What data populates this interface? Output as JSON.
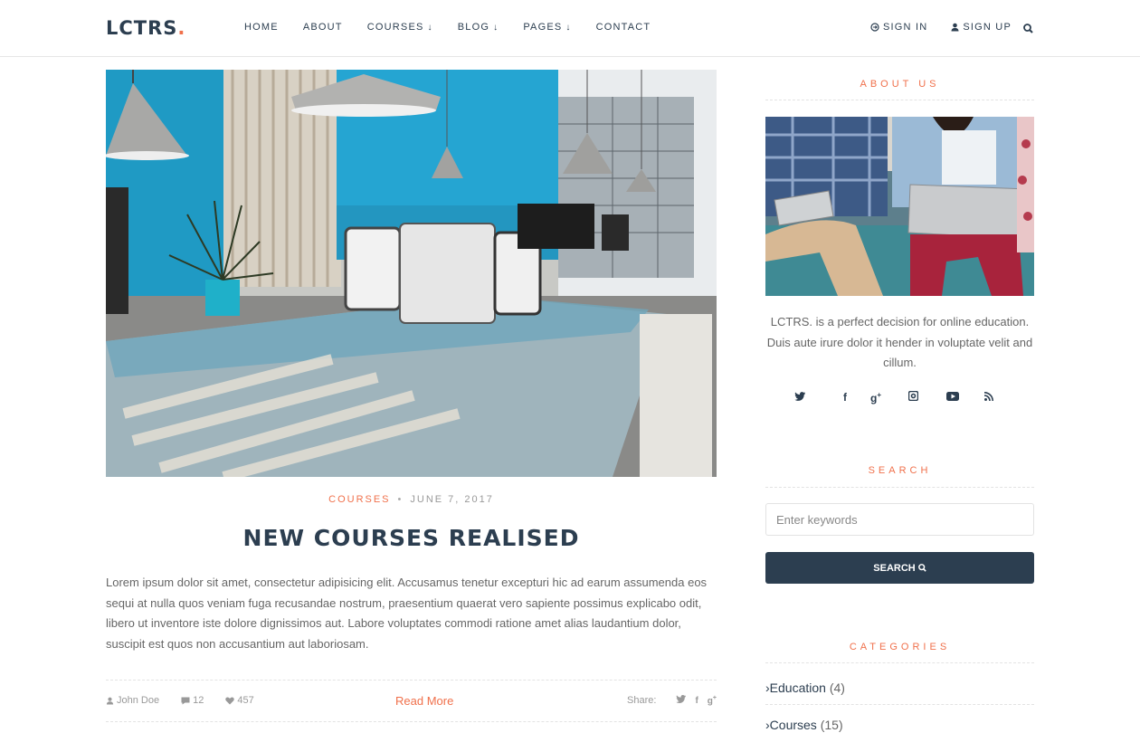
{
  "header": {
    "logo_text": "LCTRS",
    "logo_dot": ".",
    "nav": [
      {
        "label": "HOME",
        "dropdown": false
      },
      {
        "label": "ABOUT",
        "dropdown": false
      },
      {
        "label": "COURSES",
        "dropdown": true
      },
      {
        "label": "BLOG",
        "dropdown": true
      },
      {
        "label": "PAGES",
        "dropdown": true
      },
      {
        "label": "CONTACT",
        "dropdown": false
      }
    ],
    "sign_in": "SIGN IN",
    "sign_up": "SIGN UP",
    "search_icon": "search-icon"
  },
  "post": {
    "category": "COURSES",
    "separator": "•",
    "date": "JUNE 7, 2017",
    "title": "NEW COURSES REALISED",
    "body": "Lorem ipsum dolor sit amet, consectetur adipisicing elit. Accusamus tenetur excepturi hic ad earum assumenda eos sequi at nulla quos veniam fuga recusandae nostrum, praesentium quaerat vero sapiente possimus explicabo odit, libero ut inventore iste dolore dignissimos aut. Labore voluptates commodi ratione amet alias laudantium dolor, suscipit est quos non accusantium aut laboriosam.",
    "author": "John Doe",
    "comments": "12",
    "likes": "457",
    "read_more": "Read More",
    "share_label": "Share:"
  },
  "sidebar": {
    "about_title": "ABOUT US",
    "about_text": "LCTRS. is a perfect decision for online education. Duis aute irure dolor it hender in voluptate velit and cillum.",
    "socials": [
      "twitter-icon",
      "facebook-icon",
      "google-plus-icon",
      "instagram-icon",
      "youtube-icon",
      "rss-icon"
    ],
    "search_title": "SEARCH",
    "search_placeholder": "Enter keywords",
    "search_button": "SEARCH",
    "categories_title": "CATEGORIES",
    "categories": [
      {
        "name": "Education",
        "count": "(4)"
      },
      {
        "name": "Courses",
        "count": "(15)"
      }
    ]
  },
  "colors": {
    "accent": "#f0704b",
    "dark": "#2c3e50",
    "text": "#666666"
  }
}
